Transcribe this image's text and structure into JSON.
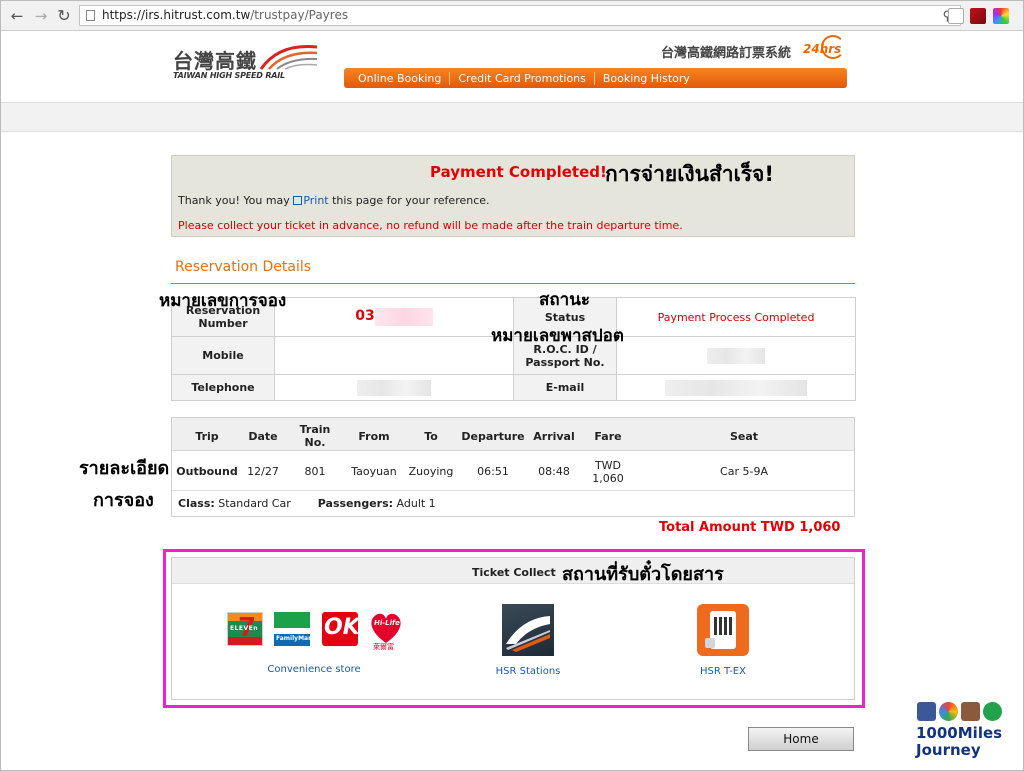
{
  "browser": {
    "url_host": "https://irs.hitrust.com.tw",
    "url_path": "/trustpay/Payres"
  },
  "header": {
    "logo_zh": "台灣高鐵",
    "logo_en": "TAIWAN HIGH SPEED RAIL",
    "system_name": "台灣高鐵網路訂票系統",
    "system_24": "24hrs",
    "nav": [
      "Online Booking",
      "Credit Card Promotions",
      "Booking History"
    ]
  },
  "completion": {
    "title": "Payment Completed!",
    "thai_caption": "การจ่ายเงินสำเร็จ!",
    "thanks_before": "Thank you! You may ",
    "print_link": "Print",
    "thanks_after": " this page for your reference.",
    "warning": "Please collect your ticket in advance, no refund will be made after the train departure time."
  },
  "reservation": {
    "section_title": "Reservation Details",
    "thai_number": "หมายเลขการจอง",
    "thai_status": "สถานะ",
    "thai_passport": "หมายเลขพาสปอต",
    "labels": {
      "number": "Reservation Number",
      "status": "Status",
      "mobile": "Mobile",
      "roc_id": "R.O.C. ID / Passport No.",
      "telephone": "Telephone",
      "email": "E-mail"
    },
    "number_prefix": "03",
    "status_value": "Payment Process Completed"
  },
  "trip": {
    "thai_details_1": "รายละเอียด",
    "thai_details_2": "การจอง",
    "headers": [
      "Trip",
      "Date",
      "Train No.",
      "From",
      "To",
      "Departure",
      "Arrival",
      "Fare",
      "Seat"
    ],
    "row": {
      "trip": "Outbound",
      "date": "12/27",
      "train": "801",
      "from": "Taoyuan",
      "to": "Zuoying",
      "departure": "06:51",
      "arrival": "08:48",
      "fare_1": "TWD",
      "fare_2": "1,060",
      "seat": "Car 5-9A"
    },
    "class_label": "Class:",
    "class_value": "Standard Car",
    "passengers_label": "Passengers:",
    "passengers_value": "Adult 1",
    "total": "Total Amount  TWD 1,060"
  },
  "ticket_collect": {
    "title": "Ticket Collect",
    "thai_caption": "สถานที่รับตั๋วโดยสาร",
    "convenience": "Convenience store",
    "hsr_stations": "HSR Stations",
    "hsr_tex": "HSR T-EX",
    "store_texts": {
      "seven": "7",
      "seven_sub": "ELEVEn",
      "familymart": "FamilyMart",
      "ok": "OK",
      "hilife": "Hi-Life",
      "hilife_zh": "萊爾富"
    }
  },
  "home_button": "Home",
  "watermark": {
    "line1": "1000Miles",
    "line2": "Journey"
  },
  "colors": {
    "accent_orange": "#e8700f",
    "alert_red": "#e10000",
    "highlight_magenta": "#ee22cc",
    "link_blue": "#1a5aa6"
  }
}
